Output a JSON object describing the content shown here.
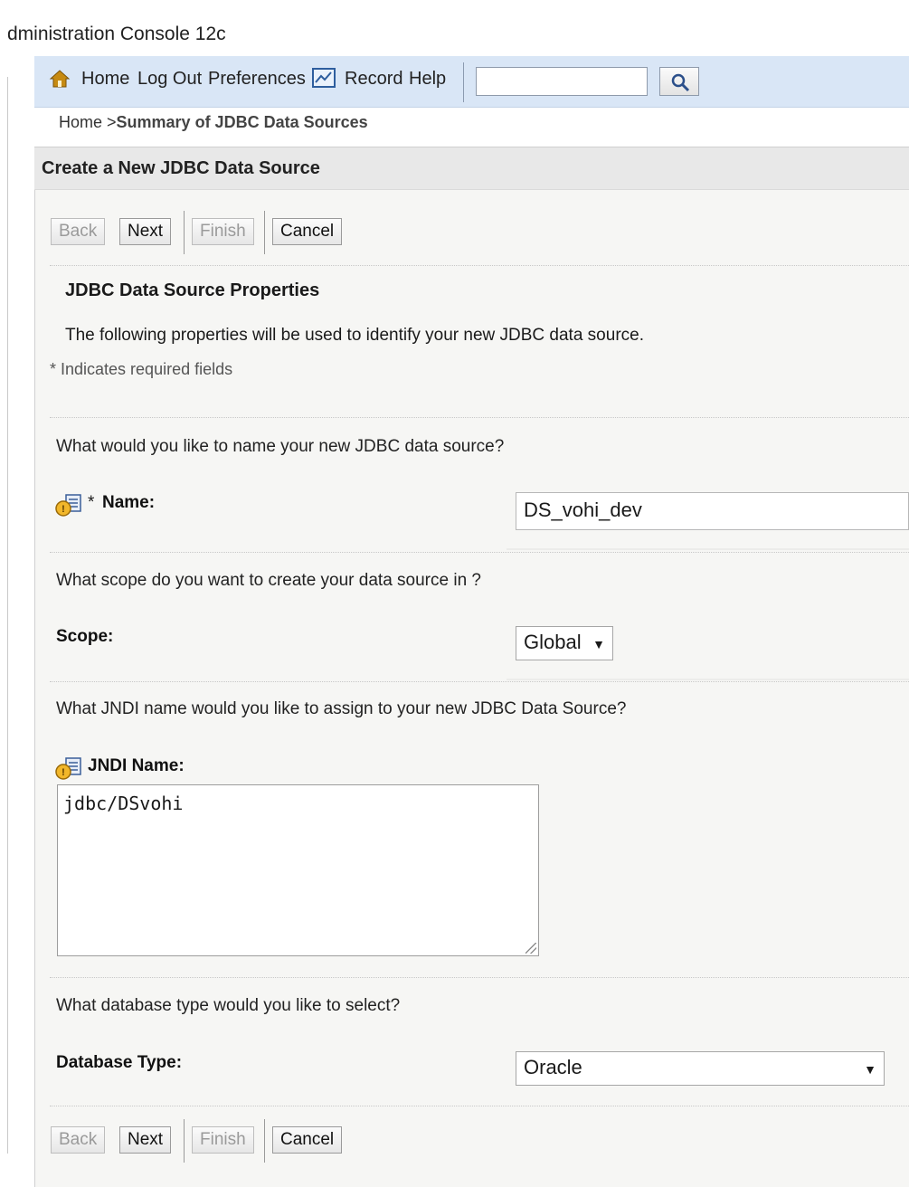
{
  "app": {
    "title": "dministration Console 12c"
  },
  "toolbar": {
    "home_label": "Home",
    "logout_label": "Log Out",
    "preferences_label": "Preferences",
    "record_label": "Record",
    "help_label": "Help",
    "search_value": ""
  },
  "breadcrumb": {
    "home": "Home >",
    "current": "Summary of JDBC Data Sources"
  },
  "panel": {
    "title": "Create a New JDBC Data Source"
  },
  "buttons": {
    "back": "Back",
    "next": "Next",
    "finish": "Finish",
    "cancel": "Cancel"
  },
  "section": {
    "title": "JDBC Data Source Properties",
    "description": "The following properties will be used to identify your new JDBC data source.",
    "required_note": "* Indicates required fields"
  },
  "fields": {
    "name": {
      "question": "What would you like to name your new JDBC data source?",
      "required_mark": "*",
      "label": "Name:",
      "value": "DS_vohi_dev"
    },
    "scope": {
      "question": "What scope do you want to create your data source in ?",
      "label": "Scope:",
      "value": "Global"
    },
    "jndi": {
      "question": "What JNDI name would you like to assign to your new JDBC Data Source?",
      "label": "JNDI Name:",
      "value": "jdbc/DSvohi"
    },
    "database_type": {
      "question": "What database type would you like to select?",
      "label": "Database Type:",
      "value": "Oracle"
    }
  },
  "colors": {
    "toolbar_bg": "#d9e6f6",
    "panel_bg": "#f6f6f4",
    "header_bg": "#e8e8e8",
    "icon_gold": "#c08a1c"
  }
}
